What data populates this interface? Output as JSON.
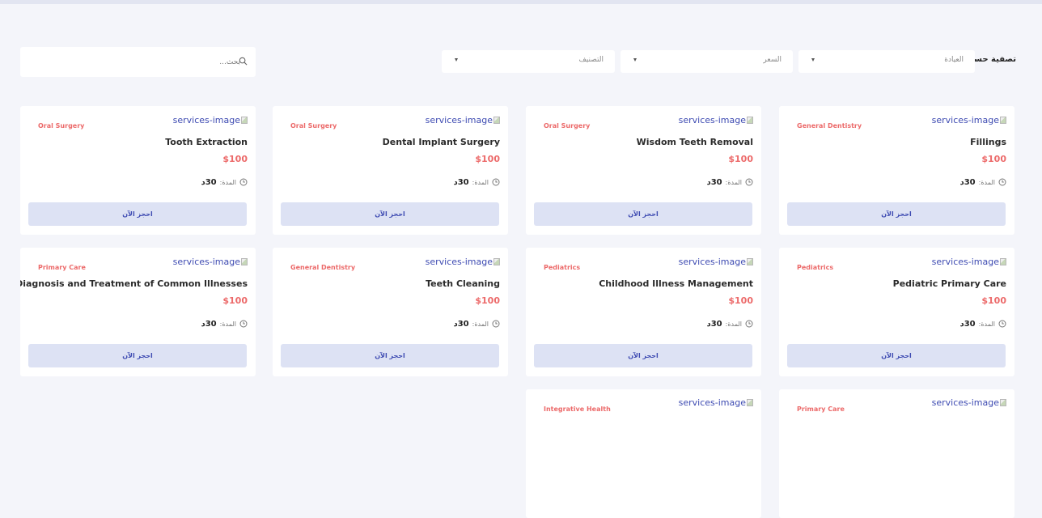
{
  "filters": {
    "label": "تصفية حسب:",
    "clinic_select": "العيادة",
    "price_select": "السعر",
    "category_select": "التصنيف"
  },
  "search": {
    "placeholder": "بحث..."
  },
  "image_alt": "services-image",
  "duration_label": "المدة:",
  "book_label": "احجز الآن",
  "services": [
    {
      "title": "Fillings",
      "category": "General Dentistry",
      "price": "$100",
      "duration": "30د"
    },
    {
      "title": "Wisdom Teeth Removal",
      "category": "Oral Surgery",
      "price": "$100",
      "duration": "30د"
    },
    {
      "title": "Dental Implant Surgery",
      "category": "Oral Surgery",
      "price": "$100",
      "duration": "30د"
    },
    {
      "title": "Tooth Extraction",
      "category": "Oral Surgery",
      "price": "$100",
      "duration": "30د"
    },
    {
      "title": "Pediatric Primary Care",
      "category": "Pediatrics",
      "price": "$100",
      "duration": "30د"
    },
    {
      "title": "Childhood Illness Management",
      "category": "Pediatrics",
      "price": "$100",
      "duration": "30د"
    },
    {
      "title": "Teeth Cleaning",
      "category": "General Dentistry",
      "price": "$100",
      "duration": "30د"
    },
    {
      "title": "Diagnosis and Treatment of Common Illnesses",
      "category": "Primary Care",
      "price": "$100",
      "duration": "30د"
    },
    {
      "title": "",
      "category": "Primary Care",
      "price": "",
      "duration": ""
    },
    {
      "title": "",
      "category": "Integrative Health",
      "price": "",
      "duration": ""
    }
  ]
}
